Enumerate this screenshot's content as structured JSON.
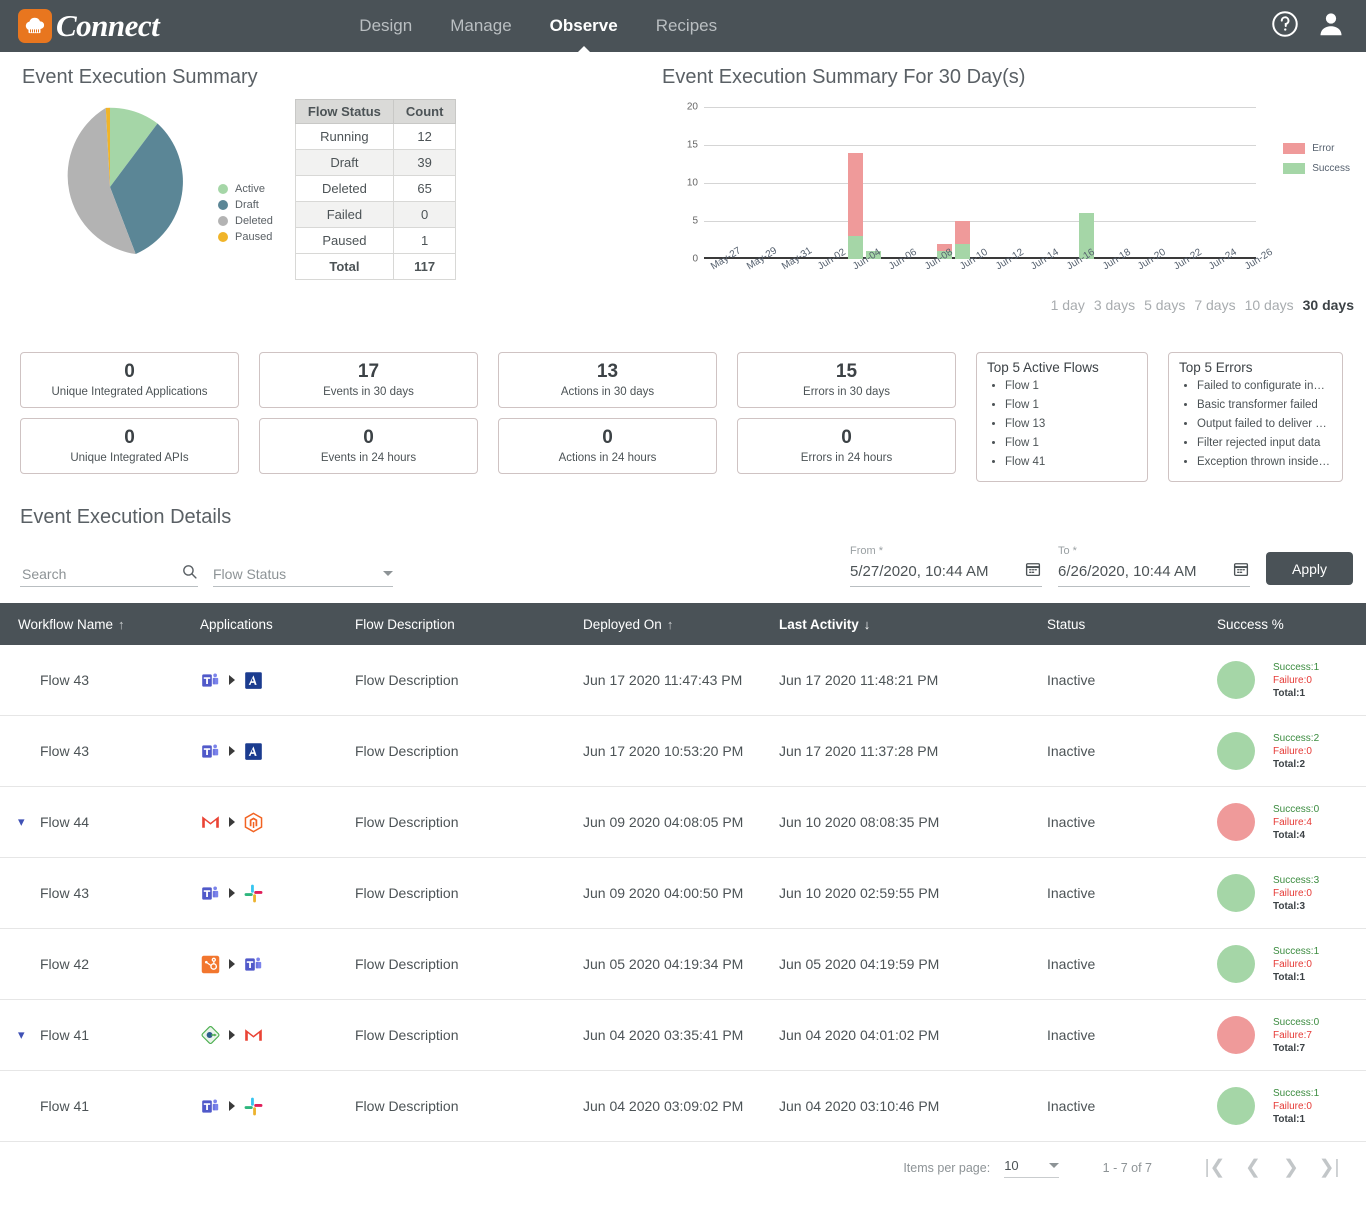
{
  "header": {
    "brand": "Connect",
    "logo_icon": "cloud-connect-logo-icon",
    "nav": [
      {
        "label": "Design",
        "active": false
      },
      {
        "label": "Manage",
        "active": false
      },
      {
        "label": "Observe",
        "active": true
      },
      {
        "label": "Recipes",
        "active": false
      }
    ],
    "help_icon": "help-circle-icon",
    "account_icon": "user-account-icon"
  },
  "pie_panel": {
    "title": "Event Execution Summary",
    "legend": [
      {
        "label": "Active",
        "color": "#a5d6a7"
      },
      {
        "label": "Draft",
        "color": "#5b8696"
      },
      {
        "label": "Deleted",
        "color": "#b3b3b3"
      },
      {
        "label": "Paused",
        "color": "#f0b429"
      }
    ],
    "table": {
      "headers": [
        "Flow Status",
        "Count"
      ],
      "rows": [
        {
          "status": "Running",
          "count": "12"
        },
        {
          "status": "Draft",
          "count": "39"
        },
        {
          "status": "Deleted",
          "count": "65"
        },
        {
          "status": "Failed",
          "count": "0"
        },
        {
          "status": "Paused",
          "count": "1"
        }
      ],
      "total": {
        "status": "Total",
        "count": "117"
      }
    }
  },
  "bar_panel": {
    "title": "Event Execution Summary For 30 Day(s)",
    "range_links": [
      {
        "label": "1 day",
        "active": false
      },
      {
        "label": "3 days",
        "active": false
      },
      {
        "label": "5 days",
        "active": false
      },
      {
        "label": "7 days",
        "active": false
      },
      {
        "label": "10 days",
        "active": false
      },
      {
        "label": "30 days",
        "active": true
      }
    ]
  },
  "chart_data": {
    "type": "bar",
    "stacked": true,
    "title": "Event Execution Summary For 30 Day(s)",
    "xlabel": "",
    "ylabel": "",
    "ylim": [
      0,
      20
    ],
    "yticks": [
      0,
      5,
      10,
      15,
      20
    ],
    "grid": true,
    "legend_position": "right",
    "categories": [
      "May-27",
      "May-28",
      "May-29",
      "May-30",
      "May-31",
      "Jun-01",
      "Jun-02",
      "Jun-03",
      "Jun-04",
      "Jun-05",
      "Jun-06",
      "Jun-07",
      "Jun-08",
      "Jun-09",
      "Jun-10",
      "Jun-11",
      "Jun-12",
      "Jun-13",
      "Jun-14",
      "Jun-15",
      "Jun-16",
      "Jun-17",
      "Jun-18",
      "Jun-19",
      "Jun-20",
      "Jun-21",
      "Jun-22",
      "Jun-23",
      "Jun-24",
      "Jun-25",
      "Jun-26"
    ],
    "tick_labels": [
      "May-27",
      "May-29",
      "May-31",
      "Jun-02",
      "Jun-04",
      "Jun-06",
      "Jun-08",
      "Jun-10",
      "Jun-12",
      "Jun-14",
      "Jun-16",
      "Jun-18",
      "Jun-20",
      "Jun-22",
      "Jun-24",
      "Jun-26"
    ],
    "series": [
      {
        "name": "Success",
        "color": "#a5d6a7",
        "values": [
          0,
          0,
          0,
          0,
          0,
          0,
          0,
          0,
          3,
          1,
          0,
          0,
          0,
          1,
          2,
          0,
          0,
          0,
          0,
          0,
          0,
          6,
          0,
          0,
          0,
          0,
          0,
          0,
          0,
          0,
          0
        ]
      },
      {
        "name": "Error",
        "color": "#ef9a9a",
        "values": [
          0,
          0,
          0,
          0,
          0,
          0,
          0,
          0,
          11,
          0,
          0,
          0,
          0,
          1,
          3,
          0,
          0,
          0,
          0,
          0,
          0,
          0,
          0,
          0,
          0,
          0,
          0,
          0,
          0,
          0,
          0
        ]
      }
    ]
  },
  "cards": [
    {
      "value": "0",
      "label": "Unique Integrated Applications"
    },
    {
      "value": "0",
      "label": "Unique Integrated APIs"
    },
    {
      "value": "17",
      "label": "Events in 30 days"
    },
    {
      "value": "0",
      "label": "Events in 24 hours"
    },
    {
      "value": "13",
      "label": "Actions in 30 days"
    },
    {
      "value": "0",
      "label": "Actions in 24 hours"
    },
    {
      "value": "15",
      "label": "Errors in 30 days"
    },
    {
      "value": "0",
      "label": "Errors in 24 hours"
    }
  ],
  "top_flows": {
    "title": "Top 5 Active Flows",
    "items": [
      "Flow  1",
      "Flow  1",
      "Flow  13",
      "Flow  1",
      "Flow  41"
    ]
  },
  "top_errors": {
    "title": "Top 5 Errors",
    "items": [
      "Failed  to  configurate  in…",
      "Basic  transformer  failed",
      "Output  failed  to  deliver  …",
      "Filter  rejected  input  data",
      "Exception  thrown  inside…"
    ]
  },
  "details": {
    "title": "Event Execution Details",
    "search_placeholder": "Search",
    "search_value": "",
    "search_icon": "search-icon",
    "flow_status_label": "Flow Status",
    "from_label": "From *",
    "from_value": "5/27/2020, 10:44 AM",
    "to_label": "To *",
    "to_value": "6/26/2020, 10:44 AM",
    "calendar_icon": "calendar-icon",
    "apply_label": "Apply",
    "refresh_icon": "refresh-icon"
  },
  "table": {
    "columns": [
      {
        "label": "Workflow Name",
        "sort": "asc",
        "active": false
      },
      {
        "label": "Applications",
        "sort": "",
        "active": false
      },
      {
        "label": "Flow Description",
        "sort": "",
        "active": false
      },
      {
        "label": "Deployed On",
        "sort": "asc",
        "active": false
      },
      {
        "label": "Last Activity",
        "sort": "desc",
        "active": true
      },
      {
        "label": "Status",
        "sort": "",
        "active": false
      },
      {
        "label": "Success %",
        "sort": "",
        "active": false
      }
    ],
    "rows": [
      {
        "expandable": false,
        "name": "Flow 43",
        "app_from": "microsoft-teams-icon",
        "app_to": "microsoft-access-icon",
        "description": "Flow Description",
        "deployed_on": "Jun 17 2020 11:47:43 PM",
        "last_activity": "Jun 17 2020 11:48:21 PM",
        "status": "Inactive",
        "indicator": "#a5d6a7",
        "success": "Success:1",
        "failure": "Failure:0",
        "total": "Total:1"
      },
      {
        "expandable": false,
        "name": "Flow 43",
        "app_from": "microsoft-teams-icon",
        "app_to": "microsoft-access-icon",
        "description": "Flow Description",
        "deployed_on": "Jun 17 2020 10:53:20 PM",
        "last_activity": "Jun 17 2020 11:37:28 PM",
        "status": "Inactive",
        "indicator": "#a5d6a7",
        "success": "Success:2",
        "failure": "Failure:0",
        "total": "Total:2"
      },
      {
        "expandable": true,
        "name": "Flow 44",
        "app_from": "gmail-icon",
        "app_to": "magento-icon",
        "description": "Flow Description",
        "deployed_on": "Jun 09 2020 04:08:05 PM",
        "last_activity": "Jun 10 2020 08:08:35 PM",
        "status": "Inactive",
        "indicator": "#ef9a9a",
        "success": "Success:0",
        "failure": "Failure:4",
        "total": "Total:4"
      },
      {
        "expandable": false,
        "name": "Flow 43",
        "app_from": "microsoft-teams-icon",
        "app_to": "slack-icon",
        "description": "Flow Description",
        "deployed_on": "Jun 09 2020 04:00:50 PM",
        "last_activity": "Jun 10 2020 02:59:55 PM",
        "status": "Inactive",
        "indicator": "#a5d6a7",
        "success": "Success:3",
        "failure": "Failure:0",
        "total": "Total:3"
      },
      {
        "expandable": false,
        "name": "Flow 42",
        "app_from": "hubspot-icon",
        "app_to": "microsoft-teams-icon",
        "description": "Flow Description",
        "deployed_on": "Jun 05 2020 04:19:34 PM",
        "last_activity": "Jun 05 2020 04:19:59 PM",
        "status": "Inactive",
        "indicator": "#a5d6a7",
        "success": "Success:1",
        "failure": "Failure:0",
        "total": "Total:1"
      },
      {
        "expandable": true,
        "name": "Flow 41",
        "app_from": "webhook-icon",
        "app_to": "gmail-icon",
        "description": "Flow Description",
        "deployed_on": "Jun 04 2020 03:35:41 PM",
        "last_activity": "Jun 04 2020 04:01:02 PM",
        "status": "Inactive",
        "indicator": "#ef9a9a",
        "success": "Success:0",
        "failure": "Failure:7",
        "total": "Total:7"
      },
      {
        "expandable": false,
        "name": "Flow 41",
        "app_from": "microsoft-teams-icon",
        "app_to": "slack-icon",
        "description": "Flow Description",
        "deployed_on": "Jun 04 2020 03:09:02 PM",
        "last_activity": "Jun 04 2020 03:10:46 PM",
        "status": "Inactive",
        "indicator": "#a5d6a7",
        "success": "Success:1",
        "failure": "Failure:0",
        "total": "Total:1"
      }
    ]
  },
  "paginator": {
    "items_per_page_label": "Items per page:",
    "items_per_page_value": "10",
    "range_label": "1 - 7 of 7",
    "first_icon": "first-page-icon",
    "prev_icon": "previous-page-icon",
    "next_icon": "next-page-icon",
    "last_icon": "last-page-icon"
  }
}
